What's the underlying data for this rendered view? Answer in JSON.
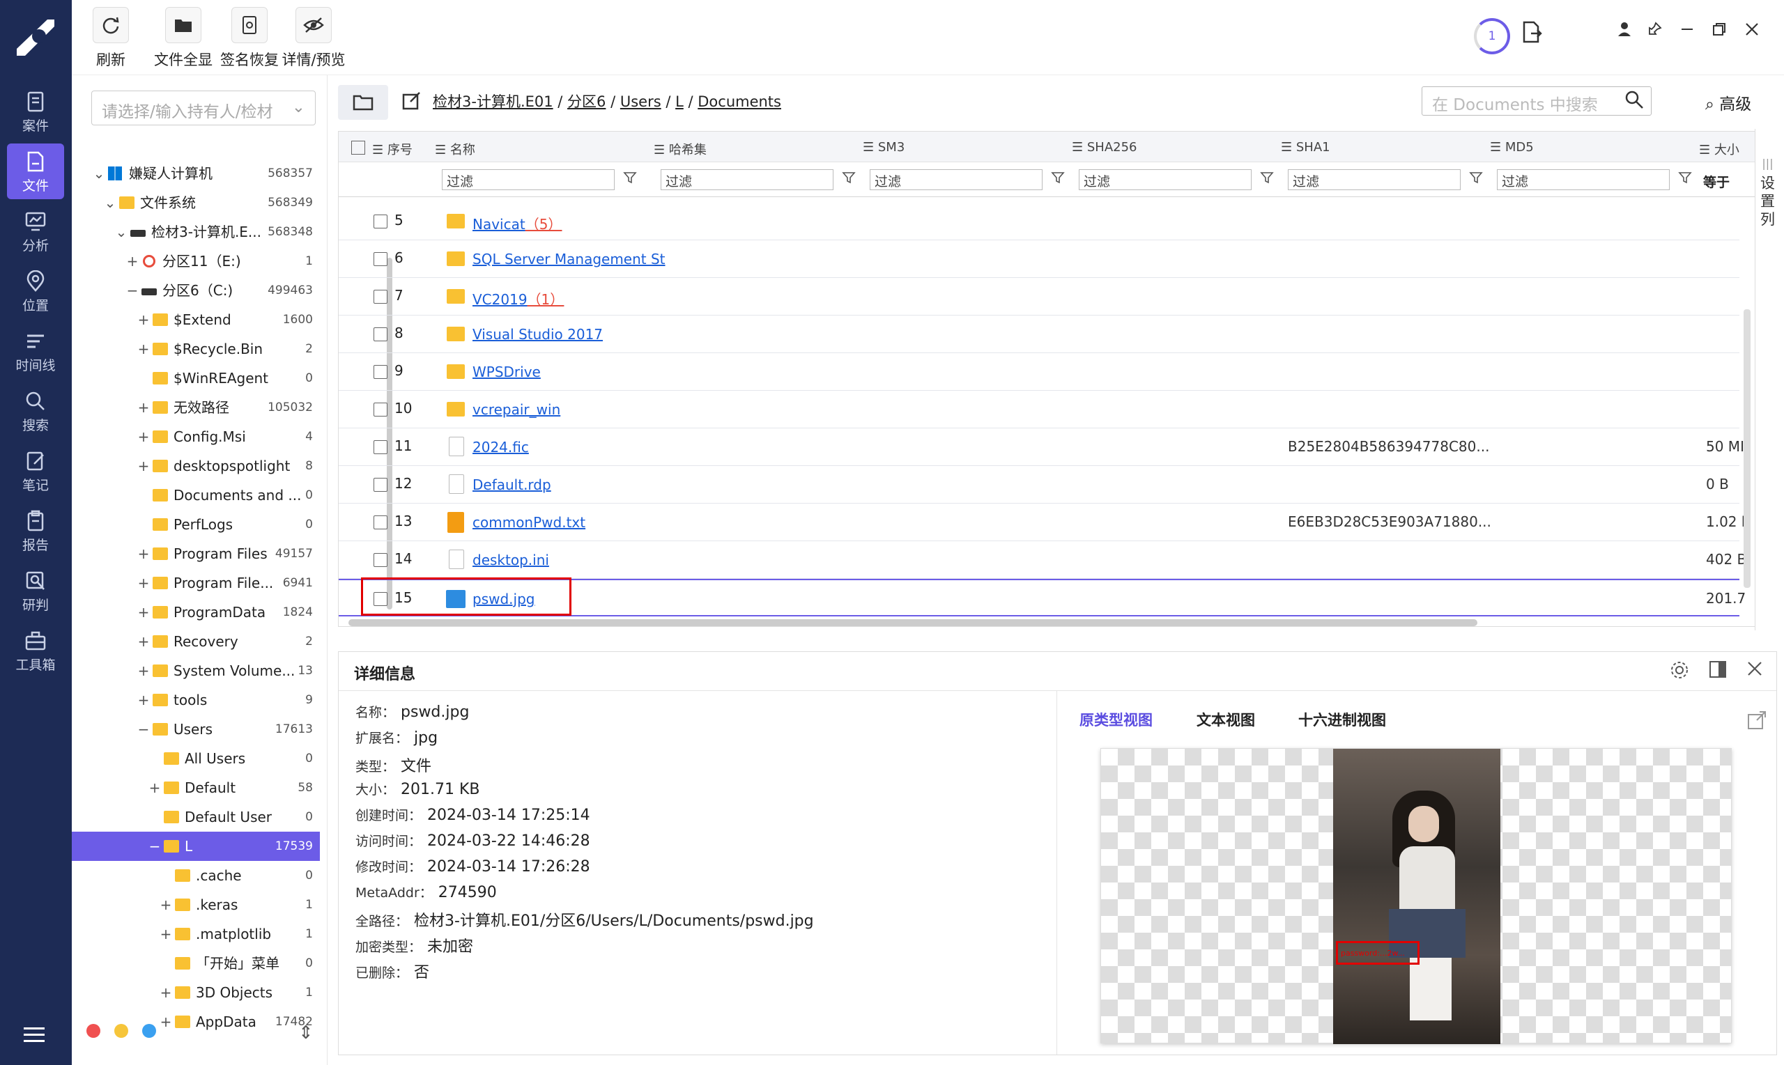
{
  "nav": {
    "items": [
      {
        "label": "案件",
        "icon": "case-icon"
      },
      {
        "label": "文件",
        "icon": "file-icon"
      },
      {
        "label": "分析",
        "icon": "analysis-icon"
      },
      {
        "label": "位置",
        "icon": "location-icon"
      },
      {
        "label": "时间线",
        "icon": "timeline-icon"
      },
      {
        "label": "搜索",
        "icon": "search-icon"
      },
      {
        "label": "笔记",
        "icon": "notes-icon"
      },
      {
        "label": "报告",
        "icon": "report-icon"
      },
      {
        "label": "研判",
        "icon": "judge-icon"
      },
      {
        "label": "工具箱",
        "icon": "toolbox-icon"
      }
    ],
    "active_index": 1
  },
  "toolbar": {
    "refresh": "刷新",
    "show_all": "文件全显",
    "sig_restore": "签名恢复",
    "detail_preview": "详情/预览",
    "task_count": "1"
  },
  "left": {
    "holder_placeholder": "请选择/输入持有人/检材",
    "tree": [
      {
        "name": "嫌疑人计算机",
        "count": "568357",
        "toggle": "⌄",
        "icon": "windows"
      },
      {
        "name": "文件系统",
        "count": "568349",
        "toggle": "⌄",
        "icon": "folder"
      },
      {
        "name": "检材3-计算机.E...",
        "count": "568348",
        "toggle": "⌄",
        "icon": "disk"
      },
      {
        "name": "分区11（E:)",
        "count": "1",
        "toggle": "+",
        "icon": "disk-red"
      },
      {
        "name": "分区6（C:)",
        "count": "499463",
        "toggle": "−",
        "icon": "disk"
      },
      {
        "name": "$Extend",
        "count": "1600",
        "toggle": "+",
        "icon": "folder"
      },
      {
        "name": "$Recycle.Bin",
        "count": "2",
        "toggle": "+",
        "icon": "folder"
      },
      {
        "name": "$WinREAgent",
        "count": "0",
        "toggle": "",
        "icon": "folder"
      },
      {
        "name": "无效路径",
        "count": "105032",
        "toggle": "+",
        "icon": "folder"
      },
      {
        "name": "Config.Msi",
        "count": "4",
        "toggle": "+",
        "icon": "folder"
      },
      {
        "name": "desktopspotlight",
        "count": "8",
        "toggle": "+",
        "icon": "folder"
      },
      {
        "name": "Documents and ...",
        "count": "0",
        "toggle": "",
        "icon": "folder"
      },
      {
        "name": "PerfLogs",
        "count": "0",
        "toggle": "",
        "icon": "folder"
      },
      {
        "name": "Program Files",
        "count": "49157",
        "toggle": "+",
        "icon": "folder"
      },
      {
        "name": "Program File...",
        "count": "6941",
        "toggle": "+",
        "icon": "folder"
      },
      {
        "name": "ProgramData",
        "count": "1824",
        "toggle": "+",
        "icon": "folder"
      },
      {
        "name": "Recovery",
        "count": "2",
        "toggle": "+",
        "icon": "folder"
      },
      {
        "name": "System Volume...",
        "count": "13",
        "toggle": "+",
        "icon": "folder"
      },
      {
        "name": "tools",
        "count": "9",
        "toggle": "+",
        "icon": "folder"
      },
      {
        "name": "Users",
        "count": "17613",
        "toggle": "−",
        "icon": "folder"
      },
      {
        "name": "All Users",
        "count": "0",
        "toggle": "",
        "icon": "folder"
      },
      {
        "name": "Default",
        "count": "58",
        "toggle": "+",
        "icon": "folder"
      },
      {
        "name": "Default User",
        "count": "0",
        "toggle": "",
        "icon": "folder"
      },
      {
        "name": "L",
        "count": "17539",
        "toggle": "−",
        "icon": "folder"
      },
      {
        "name": ".cache",
        "count": "0",
        "toggle": "",
        "icon": "folder"
      },
      {
        "name": ".keras",
        "count": "1",
        "toggle": "+",
        "icon": "folder"
      },
      {
        "name": ".matplotlib",
        "count": "1",
        "toggle": "+",
        "icon": "folder"
      },
      {
        "name": "「开始」菜单",
        "count": "0",
        "toggle": "",
        "icon": "folder"
      },
      {
        "name": "3D Objects",
        "count": "1",
        "toggle": "+",
        "icon": "folder"
      },
      {
        "name": "AppData",
        "count": "17482",
        "toggle": "+",
        "icon": "folder"
      }
    ]
  },
  "path": {
    "crumbs": [
      "检材3-计算机.E01",
      "分区6",
      "Users",
      "L",
      "Documents"
    ],
    "search_placeholder": "在 Documents 中搜索",
    "advanced": "高级"
  },
  "grid": {
    "headers": {
      "no": "序号",
      "name": "名称",
      "hashset": "哈希集",
      "sm3": "SM3",
      "sha256": "SHA256",
      "sha1": "SHA1",
      "md5": "MD5",
      "size": "大小"
    },
    "filter_placeholder": "过滤",
    "size_filter": "等于",
    "settings_column": "设置列",
    "rows": [
      {
        "no": "5",
        "name": "Navicat",
        "count": "（5）",
        "type": "folder",
        "sha1": "",
        "size": ""
      },
      {
        "no": "6",
        "name": "SQL Server Management St",
        "count": "",
        "type": "folder",
        "sha1": "",
        "size": ""
      },
      {
        "no": "7",
        "name": "VC2019",
        "count": "（1）",
        "type": "folder",
        "sha1": "",
        "size": ""
      },
      {
        "no": "8",
        "name": "Visual Studio 2017",
        "count": "",
        "type": "folder",
        "sha1": "",
        "size": ""
      },
      {
        "no": "9",
        "name": "WPSDrive",
        "count": "",
        "type": "folder",
        "sha1": "",
        "size": ""
      },
      {
        "no": "10",
        "name": "vcrepair_win",
        "count": "",
        "type": "folder",
        "sha1": "",
        "size": ""
      },
      {
        "no": "11",
        "name": "2024.fic",
        "count": "",
        "type": "file",
        "sha1": "B25E2804B586394778C80...",
        "size": "50 MI"
      },
      {
        "no": "12",
        "name": "Default.rdp",
        "count": "",
        "type": "file",
        "sha1": "",
        "size": "0 B"
      },
      {
        "no": "13",
        "name": "commonPwd.txt",
        "count": "",
        "type": "txt",
        "sha1": "E6EB3D28C53E903A71880...",
        "size": "1.02 k"
      },
      {
        "no": "14",
        "name": "desktop.ini",
        "count": "",
        "type": "file",
        "sha1": "",
        "size": "402 B"
      },
      {
        "no": "15",
        "name": "pswd.jpg",
        "count": "",
        "type": "image",
        "sha1": "",
        "size": "201.7"
      }
    ]
  },
  "detail": {
    "title": "详细信息",
    "props": [
      {
        "label": "名称：",
        "value": "pswd.jpg"
      },
      {
        "label": "扩展名：",
        "value": "jpg"
      },
      {
        "label": "类型：",
        "value": "文件"
      },
      {
        "label": "大小：",
        "value": "201.71 KB"
      },
      {
        "label": "创建时间：",
        "value": "2024-03-14 17:25:14"
      },
      {
        "label": "访问时间：",
        "value": "2024-03-22 14:46:28"
      },
      {
        "label": "修改时间：",
        "value": "2024-03-14 17:26:28"
      },
      {
        "label": "MetaAddr：",
        "value": "274590"
      },
      {
        "label": "全路径：",
        "value": "检材3-计算机.E01/分区6/Users/L/Documents/pswd.jpg"
      },
      {
        "label": "加密类型：",
        "value": "未加密"
      },
      {
        "label": "已删除：",
        "value": "否"
      }
    ],
    "tabs": [
      "原类型视图",
      "文本视图",
      "十六进制视图"
    ],
    "active_tab": 0,
    "image_text": "password:...2w..."
  },
  "colors": {
    "nav_bg": "#1d2b55",
    "accent": "#6c5ce7",
    "link": "#1a5ed8",
    "highlight": "#e10000"
  }
}
